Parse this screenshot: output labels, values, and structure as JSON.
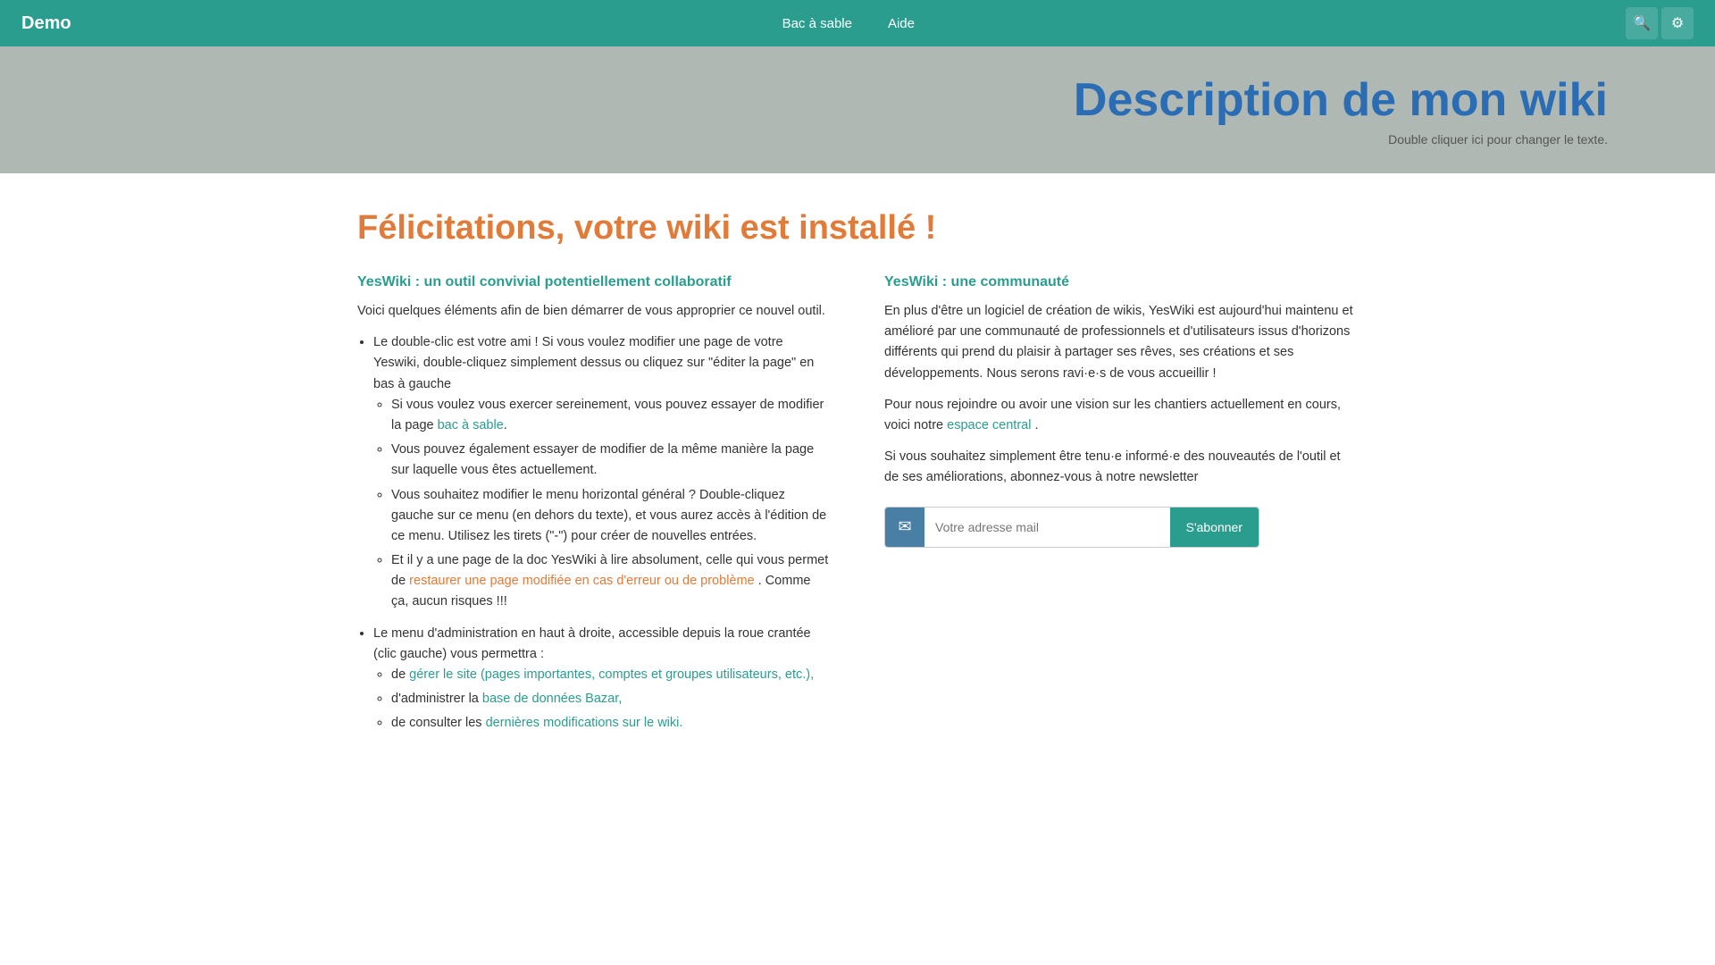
{
  "header": {
    "brand": "Demo",
    "nav": [
      {
        "label": "Bac à sable",
        "key": "bac-a-sable"
      },
      {
        "label": "Aide",
        "key": "aide"
      }
    ],
    "search_icon": "🔍",
    "settings_icon": "⚙"
  },
  "hero": {
    "title": "Description de mon wiki",
    "subtitle": "Double cliquer ici pour changer le texte."
  },
  "main": {
    "heading": "Félicitations, votre wiki est installé !",
    "left_col": {
      "section_title": "YesWiki : un outil convivial potentiellement collaboratif",
      "intro": "Voici quelques éléments afin de bien démarrer de vous approprier ce nouvel outil.",
      "bullets": [
        {
          "text": "Le double-clic est votre ami ! Si vous voulez modifier une page de votre Yeswiki, double-cliquez simplement dessus ou cliquez sur \"éditer la page\" en bas à gauche",
          "sub": [
            {
              "text": "Si vous voulez vous exercer sereinement, vous pouvez essayer de modifier la page ",
              "link": "bac à sable",
              "link_type": "teal",
              "after": "."
            },
            {
              "text": "Vous pouvez également essayer de modifier de la même manière la page sur laquelle vous êtes actuellement.",
              "link": null
            },
            {
              "text": "Vous souhaitez modifier le menu horizontal général ? Double-cliquez gauche sur ce menu (en dehors du texte), et vous aurez accès à l'édition de ce menu. Utilisez les tirets (\"-\") pour créer de nouvelles entrées.",
              "link": null
            },
            {
              "text": "Et il y a une page de la doc YesWiki à lire absolument, celle qui vous permet de ",
              "link": "restaurer une page modifiée en cas d'erreur ou de problème",
              "link_type": "orange",
              "after": ". Comme ça, aucun risques !!!"
            }
          ]
        },
        {
          "text": "Le menu d'administration en haut à droite, accessible depuis la roue crantée (clic gauche) vous permettra :",
          "sub": [
            {
              "text": "de ",
              "link": "gérer le site (pages importantes, comptes et groupes utilisateurs, etc.),",
              "link_type": "teal",
              "after": ""
            },
            {
              "text": "d'administrer la ",
              "link": "base de données Bazar,",
              "link_type": "teal",
              "after": ""
            },
            {
              "text": "de consulter les ",
              "link": "dernières modifications sur le wiki.",
              "link_type": "teal",
              "after": ""
            }
          ]
        }
      ]
    },
    "right_col": {
      "section_title": "YesWiki : une communauté",
      "para1": "En plus d'être un logiciel de création de wikis, YesWiki est aujourd'hui maintenu et amélioré par une communauté de professionnels et d'utilisateurs issus d'horizons différents qui prend du plaisir à partager ses rêves, ses créations et ses développements. Nous serons ravi·e·s de vous accueillir !",
      "para2_before": "Pour nous rejoindre ou avoir une vision sur les chantiers actuellement en cours, voici notre ",
      "para2_link": "espace central",
      "para2_after": " .",
      "para3_before": "Si vous souhaitez simplement être tenu·e informé·e des nouveautés de l'outil et de ses améliorations, abonnez-vous à notre newsletter",
      "newsletter_placeholder": "Votre adresse mail",
      "newsletter_btn": "S'abonner"
    }
  }
}
